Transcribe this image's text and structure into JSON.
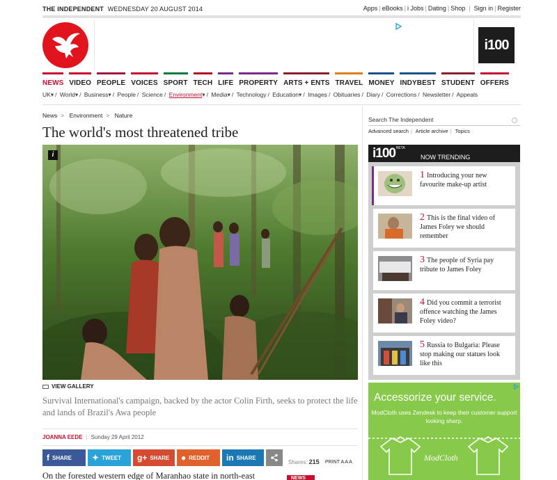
{
  "topbar": {
    "brand": "THE INDEPENDENT",
    "date": "WEDNESDAY 20 AUGUST 2014",
    "links": [
      "Apps",
      "eBooks",
      "i Jobs",
      "Dating",
      "Shop"
    ],
    "account_links": [
      "Sign in",
      "Register"
    ]
  },
  "header": {
    "i100_badge": "i100"
  },
  "nav": {
    "items": [
      {
        "label": "NEWS",
        "color": "#c8102e"
      },
      {
        "label": "VIDEO",
        "color": "#c8102e"
      },
      {
        "label": "PEOPLE",
        "color": "#a0173c"
      },
      {
        "label": "VOICES",
        "color": "#c8102e"
      },
      {
        "label": "SPORT",
        "color": "#0b7a3b"
      },
      {
        "label": "TECH",
        "color": "#b20e22"
      },
      {
        "label": "LIFE",
        "color": "#7a2a8c"
      },
      {
        "label": "PROPERTY",
        "color": "#7a2a8c"
      },
      {
        "label": "ARTS + ENTS",
        "color": "#8a1e2e"
      },
      {
        "label": "TRAVEL",
        "color": "#e07b1a"
      },
      {
        "label": "MONEY",
        "color": "#1a4f8c"
      },
      {
        "label": "INDYBEST",
        "color": "#1a4f8c"
      },
      {
        "label": "STUDENT",
        "color": "#8a1e2e"
      },
      {
        "label": "OFFERS",
        "color": "#c8102e"
      }
    ],
    "subnav": [
      {
        "label": "UK",
        "dropdown": true
      },
      {
        "label": "World",
        "dropdown": true
      },
      {
        "label": "Business",
        "dropdown": true
      },
      {
        "label": "People"
      },
      {
        "label": "Science"
      },
      {
        "label": "Environment",
        "dropdown": true,
        "active": true
      },
      {
        "label": "Media",
        "dropdown": true
      },
      {
        "label": "Technology"
      },
      {
        "label": "Education",
        "dropdown": true
      },
      {
        "label": "Images"
      },
      {
        "label": "Obituaries"
      },
      {
        "label": "Diary"
      },
      {
        "label": "Corrections"
      },
      {
        "label": "Newsletter"
      },
      {
        "label": "Appeals"
      }
    ]
  },
  "article": {
    "breadcrumb": [
      "News",
      "Environment",
      "Nature"
    ],
    "headline": "The world's most threatened tribe",
    "gallery_label": "VIEW GALLERY",
    "standfirst": "Survival International's campaign, backed by the actor Colin Firth, seeks to protect the life and lands of Brazil's Awa people",
    "author": "JOANNA EEDE",
    "date": "Sunday 29 April 2012",
    "share": {
      "facebook": "SHARE",
      "twitter": "TWEET",
      "google": "SHARE",
      "reddit": "REDDIT",
      "linkedin": "SHARE",
      "shares_label": "Shares:",
      "shares_count": "215",
      "print": "PRINT",
      "text_size": "A A A"
    },
    "body_start": "On the forested western edge of Maranhao state in north-east",
    "news_tag": "NEWS"
  },
  "sidebar": {
    "search_placeholder": "Search The Independent",
    "search_links": [
      "Advanced search",
      "Article archive",
      "Topics"
    ],
    "trending_logo": "i100",
    "trending_beta": "BETA",
    "trending_title": "NOW TRENDING",
    "trending": [
      {
        "num": "1",
        "text": "Introducing your new favourite make-up artist"
      },
      {
        "num": "2",
        "text": "This is the final video of James Foley we should remember"
      },
      {
        "num": "3",
        "text": "The people of Syria pay tribute to James Foley"
      },
      {
        "num": "4",
        "text": "Did you commit a terrorist offence watching the James Foley video?"
      },
      {
        "num": "5",
        "text": "Russia to Bulgaria: Please stop making our statues look like this"
      }
    ]
  },
  "ad": {
    "headline": "Accessorize your service.",
    "sub": "ModCloth uses Zendesk to keep their customer support looking sharp.",
    "brand": "ModCloth"
  }
}
